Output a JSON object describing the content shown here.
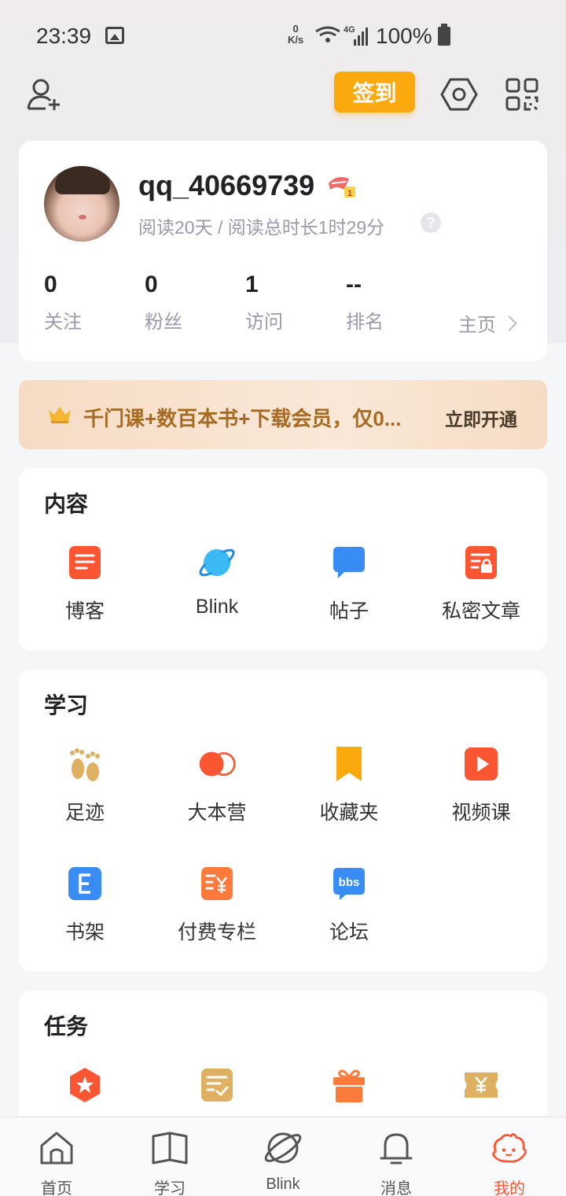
{
  "status_bar": {
    "time": "23:39",
    "speed_value": "0",
    "speed_unit": "K/s",
    "network": "4G",
    "battery": "100%"
  },
  "topbar": {
    "checkin_label": "签到",
    "icons": [
      "add-user-icon",
      "settings-icon",
      "qr-code-icon"
    ]
  },
  "profile": {
    "username": "qq_40669739",
    "reading_info": "阅读20天 / 阅读总时长1时29分",
    "help": "?",
    "stats": [
      {
        "value": "0",
        "label": "关注"
      },
      {
        "value": "0",
        "label": "粉丝"
      },
      {
        "value": "1",
        "label": "访问"
      },
      {
        "value": "--",
        "label": "排名"
      }
    ],
    "homepage_label": "主页"
  },
  "vip": {
    "text": "千门课+数百本书+下载会员，仅0...",
    "cta": "立即开通"
  },
  "content_section": {
    "title": "内容",
    "items": [
      {
        "label": "博客",
        "icon": "blog-icon",
        "color": "#fc5531"
      },
      {
        "label": "Blink",
        "icon": "planet-icon",
        "color": "#3ab9f5"
      },
      {
        "label": "帖子",
        "icon": "chat-bubble-icon",
        "color": "#3a8cf5"
      },
      {
        "label": "私密文章",
        "icon": "private-article-icon",
        "color": "#fc5531"
      }
    ]
  },
  "study_section": {
    "title": "学习",
    "items": [
      {
        "label": "足迹",
        "icon": "footprint-icon",
        "color": "#e0b062"
      },
      {
        "label": "大本营",
        "icon": "camp-icon",
        "color": "#fc5531"
      },
      {
        "label": "收藏夹",
        "icon": "bookmark-icon",
        "color": "#fca90d"
      },
      {
        "label": "视频课",
        "icon": "video-icon",
        "color": "#fc5531"
      },
      {
        "label": "书架",
        "icon": "bookshelf-icon",
        "color": "#3a8cf5"
      },
      {
        "label": "付费专栏",
        "icon": "paid-column-icon",
        "color": "#fc7a3a"
      },
      {
        "label": "论坛",
        "icon": "forum-icon",
        "color": "#3a8cf5"
      }
    ]
  },
  "task_section": {
    "title": "任务",
    "items": [
      {
        "icon": "star-badge-icon",
        "color": "#fc5531"
      },
      {
        "icon": "task-list-icon",
        "color": "#e0b062"
      },
      {
        "icon": "gift-icon",
        "color": "#fc7a3a"
      },
      {
        "icon": "coupon-icon",
        "color": "#e0b062"
      }
    ]
  },
  "tabbar": {
    "tabs": [
      {
        "label": "首页",
        "icon": "home-icon"
      },
      {
        "label": "学习",
        "icon": "book-icon"
      },
      {
        "label": "Blink",
        "icon": "planet-icon"
      },
      {
        "label": "消息",
        "icon": "bell-icon"
      },
      {
        "label": "我的",
        "icon": "mascot-icon",
        "active": true
      }
    ],
    "active_color": "#fc5531"
  }
}
